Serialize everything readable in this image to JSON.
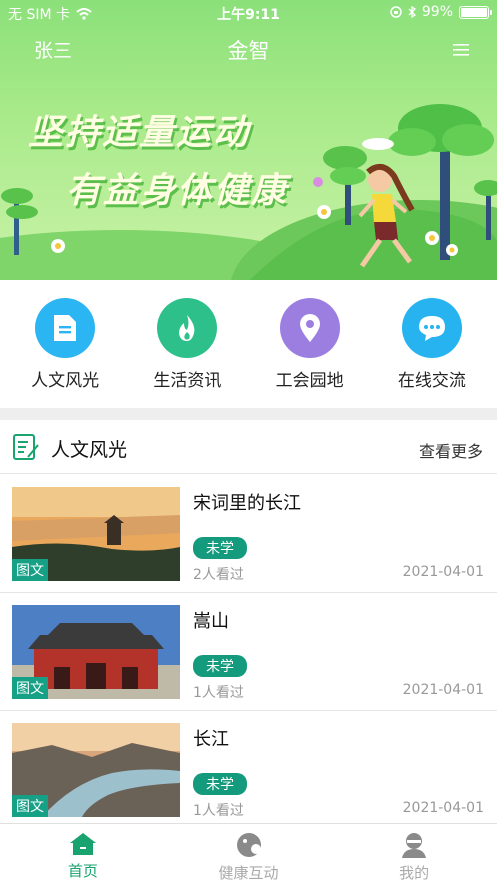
{
  "status_bar": {
    "carrier": "无 SIM 卡",
    "time": "上午9:11",
    "battery": "99%",
    "battery_level": 0.99
  },
  "nav": {
    "user": "张三",
    "title": "金智",
    "menu_icon": "menu-icon"
  },
  "banner": {
    "line1": "坚持适量运动",
    "line2": "有益身体健康"
  },
  "categories": [
    {
      "label": "人文风光",
      "icon": "document-icon",
      "color": "#2bb5f2"
    },
    {
      "label": "生活资讯",
      "icon": "flame-icon",
      "color": "#2ec08a"
    },
    {
      "label": "工会园地",
      "icon": "location-pin-icon",
      "color": "#9b7ee0"
    },
    {
      "label": "在线交流",
      "icon": "chat-bubble-icon",
      "color": "#27b3f0"
    }
  ],
  "section": {
    "title": "人文风光",
    "more": "查看更多"
  },
  "articles": [
    {
      "title": "宋词里的长江",
      "tag": "图文",
      "status": "未学",
      "views": "2人看过",
      "date": "2021-04-01"
    },
    {
      "title": "嵩山",
      "tag": "图文",
      "status": "未学",
      "views": "1人看过",
      "date": "2021-04-01"
    },
    {
      "title": "长江",
      "tag": "图文",
      "status": "未学",
      "views": "1人看过",
      "date": "2021-04-01"
    }
  ],
  "tabbar": [
    {
      "label": "首页",
      "icon": "home-icon",
      "active": true
    },
    {
      "label": "健康互动",
      "icon": "health-icon",
      "active": false
    },
    {
      "label": "我的",
      "icon": "profile-icon",
      "active": false
    }
  ],
  "colors": {
    "accent": "#18a36f",
    "badge": "#149a7c",
    "banner_green": "#8be07a"
  }
}
